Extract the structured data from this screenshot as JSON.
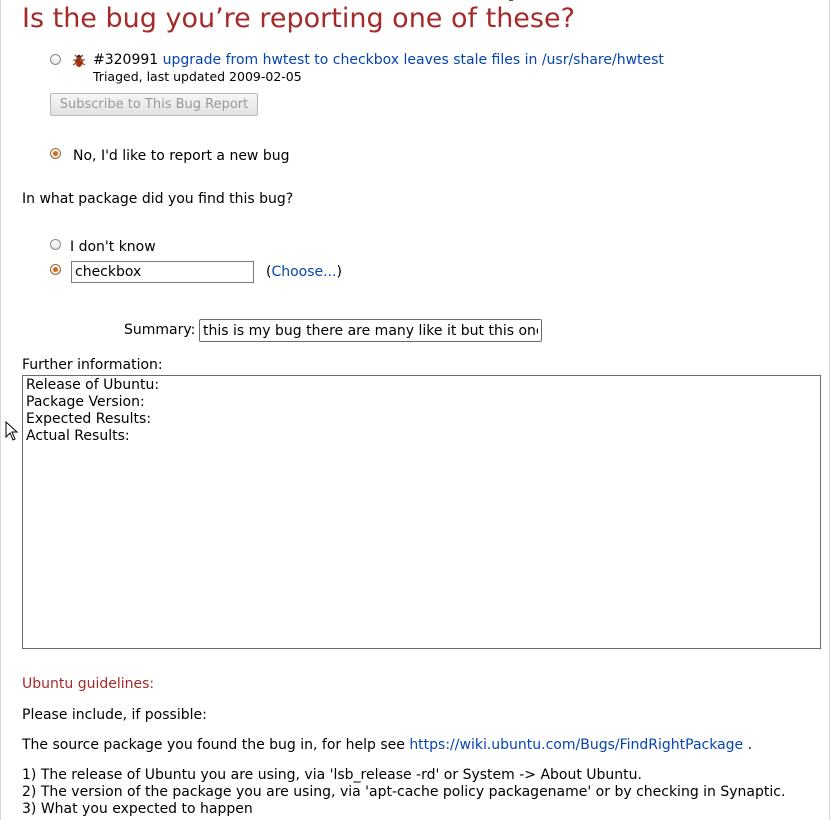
{
  "heading": "Is the bug you’re reporting one of these?",
  "similar_bug": {
    "number": "#320991",
    "title": "upgrade from hwtest to checkbox leaves stale files in /usr/share/hwtest",
    "status_line": "Triaged, last updated 2009-02-05",
    "icon": "bug-icon"
  },
  "subscribe_button": "Subscribe to This Bug Report",
  "new_bug_option": "No, I'd like to report a new bug",
  "package": {
    "question": "In what package did you find this bug?",
    "dont_know_label": "I don't know",
    "value": "checkbox",
    "choose_open": "(",
    "choose_link": "Choose...",
    "choose_close": ")"
  },
  "summary": {
    "label": "Summary:",
    "value": "this is my bug there are many like it but this one is"
  },
  "further": {
    "label": "Further information:",
    "value": "Release of Ubuntu:\nPackage Version:\nExpected Results:\nActual Results:"
  },
  "guidelines": {
    "title": "Ubuntu guidelines:",
    "intro": "Please include, if possible:",
    "source_prefix": "The source package you found the bug in, for help see",
    "source_link": "https://wiki.ubuntu.com/Bugs/FindRightPackage",
    "source_suffix": ".",
    "items": [
      "1) The release of Ubuntu you are using, via 'lsb_release -rd' or System -> About Ubuntu.",
      "2) The version of the package you are using, via 'apt-cache policy packagename' or by checking in Synaptic.",
      "3) What you expected to happen"
    ]
  },
  "colors": {
    "heading": "#a52a2a",
    "link": "#0645ad",
    "radio_selected": "#d86c10"
  }
}
